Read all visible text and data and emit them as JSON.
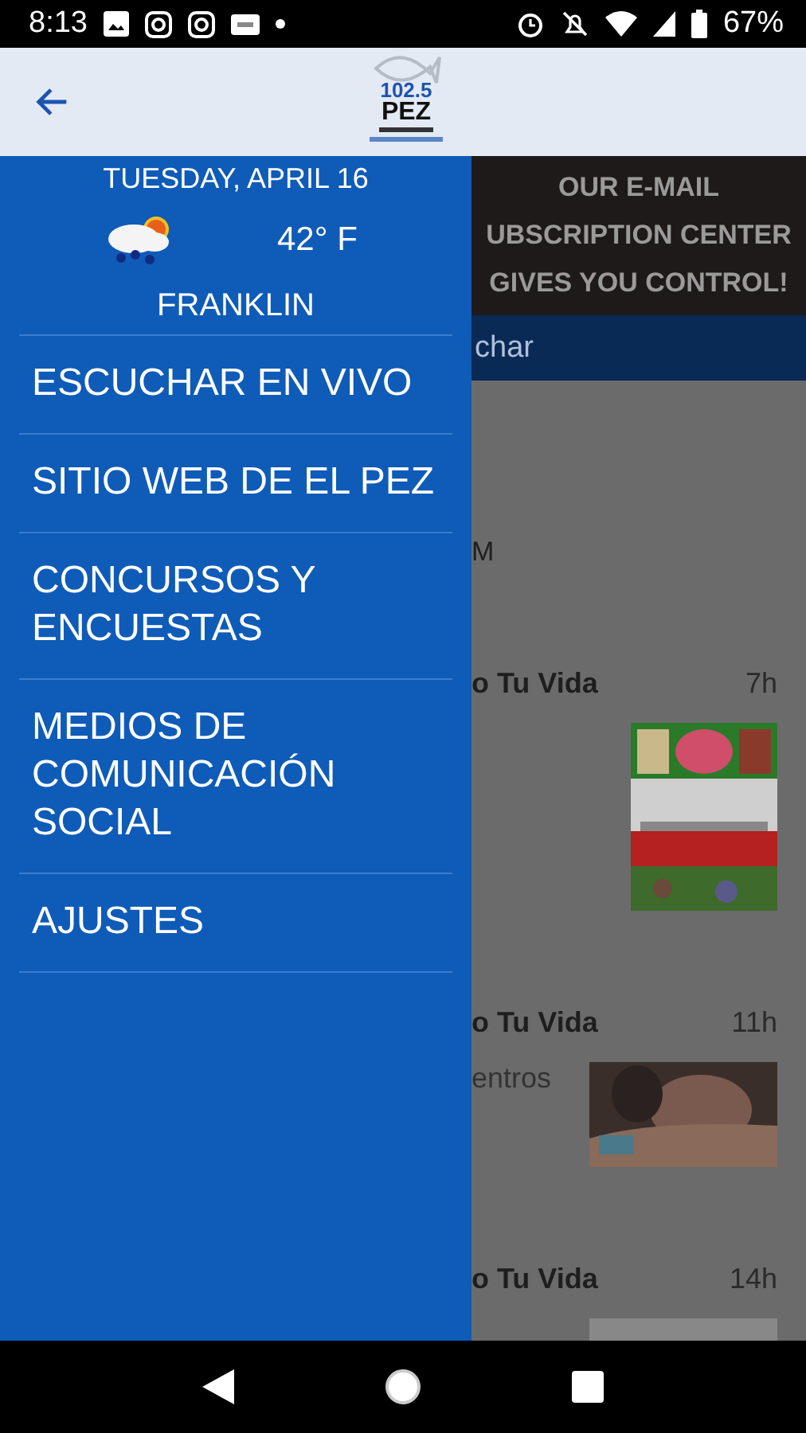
{
  "status_bar": {
    "time": "8:13",
    "battery": "67%"
  },
  "app_bar": {
    "logo": {
      "frequency": "102.5",
      "name": "PEZ"
    }
  },
  "drawer": {
    "date": "TUESDAY, APRIL 16",
    "temperature": "42° F",
    "city": "FRANKLIN",
    "items": [
      {
        "label": "ESCUCHAR EN VIVO"
      },
      {
        "label": "SITIO WEB DE EL PEZ"
      },
      {
        "label": "CONCURSOS Y ENCUESTAS"
      },
      {
        "label": "MEDIOS DE COMUNICACIÓN SOCIAL"
      },
      {
        "label": "AJUSTES"
      }
    ]
  },
  "background": {
    "banner": [
      "OUR E-MAIL",
      "UBSCRIPTION CENTER",
      "GIVES YOU CONTROL!"
    ],
    "tab": "char",
    "text_1": "M",
    "posts": [
      {
        "title": "o Tu Vida",
        "age": "7h"
      },
      {
        "title": "o Tu Vida",
        "age": "11h",
        "snippet": "entros"
      },
      {
        "title": "o Tu Vida",
        "age": "14h"
      }
    ]
  }
}
